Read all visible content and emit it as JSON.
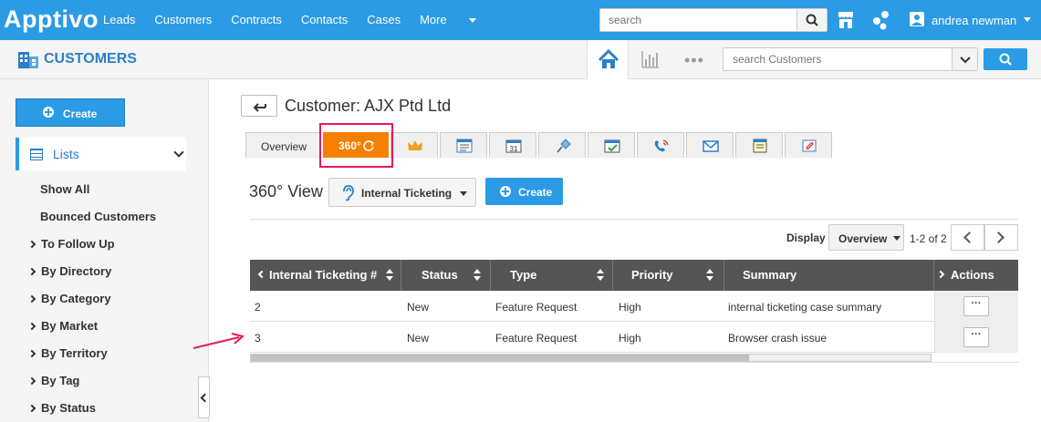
{
  "app": {
    "logo_text": "Apptivo"
  },
  "topnav": {
    "items": [
      "Leads",
      "Customers",
      "Contracts",
      "Contacts",
      "Cases",
      "More"
    ],
    "search_placeholder": "search",
    "user_name": "andrea newman"
  },
  "module": {
    "title": "CUSTOMERS",
    "search_placeholder": "search Customers"
  },
  "sidebar": {
    "create_label": "Create",
    "lists_label": "Lists",
    "items": [
      {
        "label": "Show All",
        "expandable": false
      },
      {
        "label": "Bounced Customers",
        "expandable": false
      },
      {
        "label": "To Follow Up",
        "expandable": true
      },
      {
        "label": "By Directory",
        "expandable": true
      },
      {
        "label": "By Category",
        "expandable": true
      },
      {
        "label": "By Market",
        "expandable": true
      },
      {
        "label": "By Territory",
        "expandable": true
      },
      {
        "label": "By Tag",
        "expandable": true
      },
      {
        "label": "By Status",
        "expandable": true
      }
    ]
  },
  "page": {
    "title": "Customer: AJX Ptd Ltd",
    "tabs": {
      "overview": "Overview",
      "t360": "360°",
      "icon_tabs": [
        "crown-icon",
        "notes-icon",
        "calendar-icon",
        "pin-icon",
        "task-check-icon",
        "call-icon",
        "email-icon",
        "document-icon",
        "attachment-icon"
      ]
    },
    "calendar_day": "31",
    "view_title": "360° View",
    "view_selector": "Internal Ticketing",
    "create_label": "Create",
    "display_label": "Display",
    "display_value": "Overview",
    "pager": "1-2 of 2"
  },
  "table": {
    "headers": [
      "Internal Ticketing #",
      "Status",
      "Type",
      "Priority",
      "Summary",
      "Actions"
    ],
    "rows": [
      {
        "id": "2",
        "status": "New",
        "type": "Feature Request",
        "priority": "High",
        "summary": "internal ticketing case summary"
      },
      {
        "id": "3",
        "status": "New",
        "type": "Feature Request",
        "priority": "High",
        "summary": "Browser crash issue"
      }
    ],
    "action_label": "···"
  },
  "colors": {
    "brand": "#2a9be4",
    "accent_tab": "#f77f00",
    "highlight": "#e8195a",
    "table_header": "#555555"
  }
}
